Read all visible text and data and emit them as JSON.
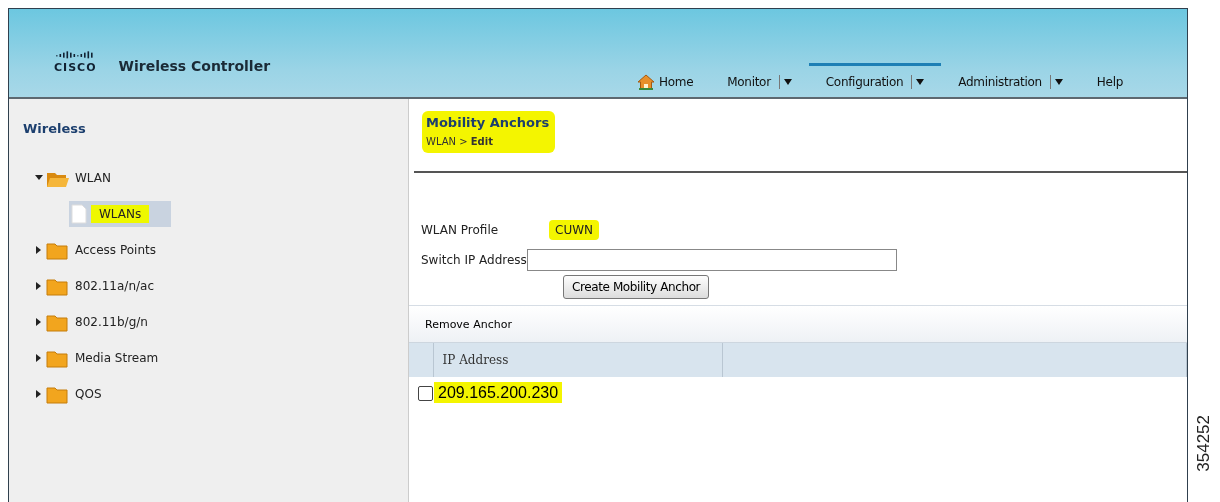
{
  "header": {
    "logo_text": "CISCO",
    "title": "Wireless Controller",
    "nav": [
      {
        "label": "Home",
        "kind": "home",
        "has_menu": false,
        "selected": false
      },
      {
        "label": "Monitor",
        "kind": "menu",
        "has_menu": true,
        "selected": false
      },
      {
        "label": "Configuration",
        "kind": "menu",
        "has_menu": true,
        "selected": true
      },
      {
        "label": "Administration",
        "kind": "menu",
        "has_menu": true,
        "selected": false
      },
      {
        "label": "Help",
        "kind": "menu",
        "has_menu": false,
        "selected": false
      }
    ]
  },
  "sidebar": {
    "title": "Wireless",
    "tree": [
      {
        "label": "WLAN",
        "expanded": true,
        "children": [
          {
            "label": "WLANs",
            "selected": true,
            "highlighted": true
          }
        ]
      },
      {
        "label": "Access Points",
        "expanded": false
      },
      {
        "label": "802.11a/n/ac",
        "expanded": false
      },
      {
        "label": "802.11b/g/n",
        "expanded": false
      },
      {
        "label": "Media Stream",
        "expanded": false
      },
      {
        "label": "QOS",
        "expanded": false
      }
    ]
  },
  "content": {
    "title": "Mobility Anchors",
    "breadcrumb": "WLAN > **Edit**",
    "heading_highlighted": true,
    "wlan_profile": {
      "label": "WLAN Profile",
      "value": "CUWN",
      "highlighted": true
    },
    "switch_ip": {
      "label": "Switch IP Address"
    },
    "create_button": "Create Mobility Anchor",
    "toolbar": {
      "action": "Remove Anchor"
    },
    "table": {
      "columns": [
        "IP Address"
      ],
      "rows": [
        {
          "checked": false,
          "ip": "209.165.200.230",
          "highlighted": true
        }
      ]
    }
  },
  "figure_number": "354252"
}
